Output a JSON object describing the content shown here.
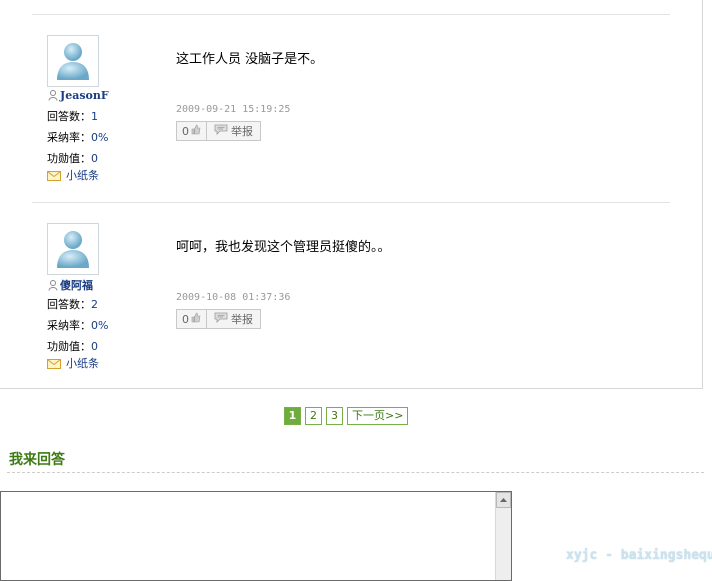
{
  "posts": [
    {
      "username": "JeasonF",
      "stats": [
        {
          "label": "回答数：",
          "value": "1"
        },
        {
          "label": "采纳率：",
          "value": "0%"
        },
        {
          "label": "功勋值：",
          "value": "0"
        }
      ],
      "note_label": "小纸条",
      "content": "这工作人员 没脑子是不。",
      "time": "2009-09-21 15:19:25",
      "like_count": "0",
      "report_label": "举报"
    },
    {
      "username": "傻阿福",
      "stats": [
        {
          "label": "回答数：",
          "value": "2"
        },
        {
          "label": "采纳率：",
          "value": "0%"
        },
        {
          "label": "功勋值：",
          "value": "0"
        }
      ],
      "note_label": "小纸条",
      "content": "呵呵，我也发现这个管理员挺傻的。。",
      "time": "2009-10-08 01:37:36",
      "like_count": "0",
      "report_label": "举报"
    }
  ],
  "pagination": {
    "pages": [
      "1",
      "2",
      "3"
    ],
    "current": "1",
    "next_label": "下一页>>"
  },
  "reply": {
    "title": "我来回答"
  },
  "watermark": "xyjc - baixingshequ",
  "colors": {
    "accent_green": "#6eac3d",
    "link_blue": "#1a3c84",
    "title_green": "#3c7a12"
  },
  "icons": {
    "avatar": "default-avatar-icon",
    "user": "person-icon",
    "note": "envelope-icon",
    "like": "thumbs-up-icon",
    "report": "speech-bubble-icon"
  }
}
